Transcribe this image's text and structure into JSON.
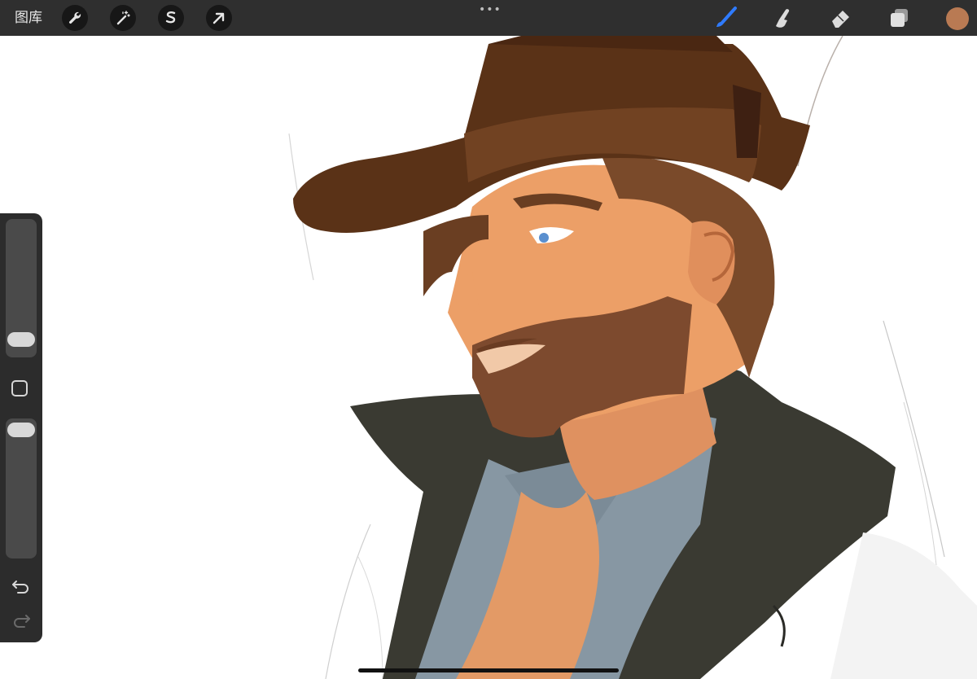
{
  "toolbar": {
    "gallery_label": "图库",
    "left_tools": [
      {
        "name": "actions",
        "icon": "wrench-icon"
      },
      {
        "name": "adjustments",
        "icon": "magic-wand-icon"
      },
      {
        "name": "selection",
        "icon": "selection-s-icon"
      },
      {
        "name": "transform",
        "icon": "arrow-cursor-icon"
      }
    ],
    "more_label": "•••",
    "right_tools": [
      {
        "name": "brush",
        "icon": "brush-icon",
        "active": true
      },
      {
        "name": "smudge",
        "icon": "smudge-finger-icon",
        "active": false
      },
      {
        "name": "eraser",
        "icon": "eraser-icon",
        "active": false
      },
      {
        "name": "layers",
        "icon": "layers-icon",
        "active": false
      }
    ],
    "current_color": "#b97a53",
    "active_color": "#2f7bff"
  },
  "sidebar": {
    "brush_size": 0.1,
    "opacity": 1.0,
    "modifier_icon": "square-modifier-icon",
    "undo_icon": "undo-icon",
    "redo_icon": "redo-icon",
    "redo_enabled": false
  }
}
